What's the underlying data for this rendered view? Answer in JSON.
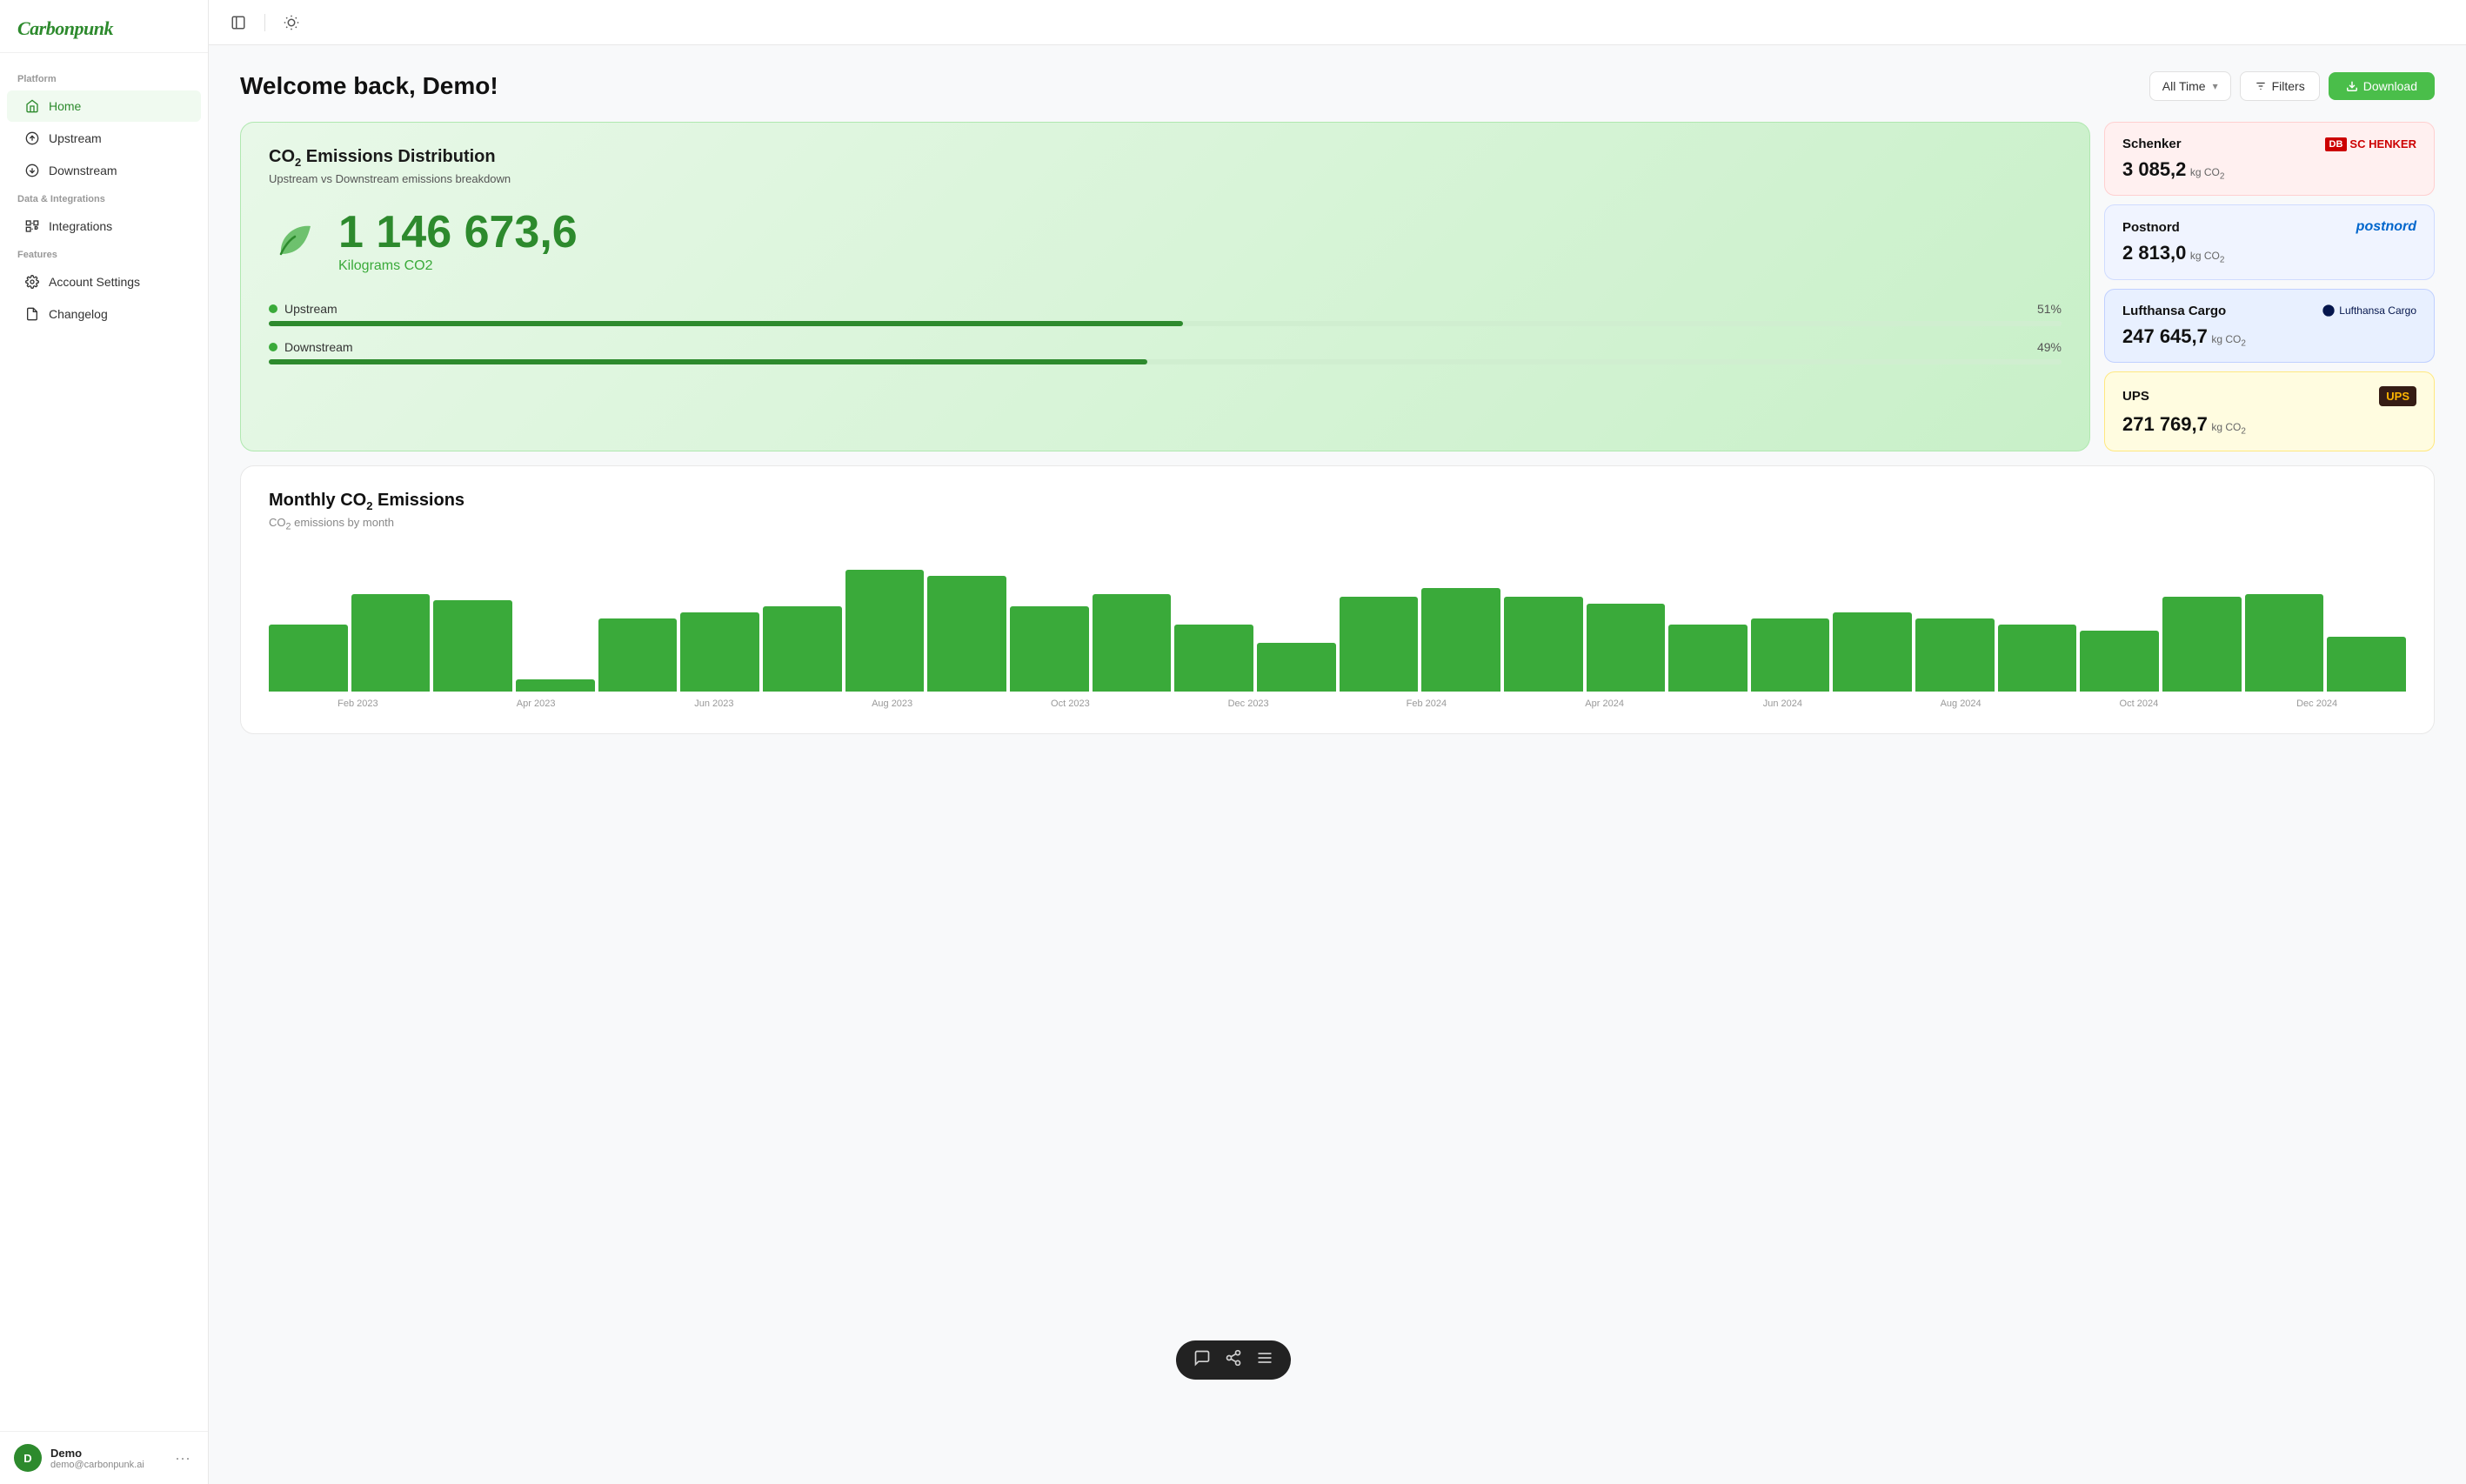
{
  "app": {
    "name": "Carbonpunk"
  },
  "sidebar": {
    "platform_label": "Platform",
    "data_integrations_label": "Data & Integrations",
    "features_label": "Features",
    "items": [
      {
        "id": "home",
        "label": "Home",
        "active": true
      },
      {
        "id": "upstream",
        "label": "Upstream",
        "active": false
      },
      {
        "id": "downstream",
        "label": "Downstream",
        "active": false
      },
      {
        "id": "integrations",
        "label": "Integrations",
        "active": false
      },
      {
        "id": "account-settings",
        "label": "Account Settings",
        "active": false
      },
      {
        "id": "changelog",
        "label": "Changelog",
        "active": false
      }
    ]
  },
  "user": {
    "initial": "D",
    "name": "Demo",
    "email": "demo@carbonpunk.ai"
  },
  "header": {
    "title": "Welcome back, Demo!",
    "time_select": "All Time",
    "filters_label": "Filters",
    "download_label": "Download"
  },
  "emissions_card": {
    "title": "CO₂ Emissions Distribution",
    "subtitle": "Upstream vs Downstream emissions breakdown",
    "value": "1 146 673,6",
    "unit": "Kilograms CO2",
    "upstream_label": "Upstream",
    "upstream_pct": "51%",
    "upstream_fill": 51,
    "downstream_label": "Downstream",
    "downstream_pct": "49%",
    "downstream_fill": 49
  },
  "carriers": [
    {
      "name": "Schenker",
      "logo_type": "schenker",
      "value": "3 085,2",
      "unit": "kg CO₂",
      "theme": "pink"
    },
    {
      "name": "Postnord",
      "logo_type": "postnord",
      "value": "2 813,0",
      "unit": "kg CO₂",
      "theme": "blue-light"
    },
    {
      "name": "Lufthansa Cargo",
      "logo_type": "lufthansa",
      "value": "247 645,7",
      "unit": "kg CO₂",
      "theme": "blue"
    },
    {
      "name": "UPS",
      "logo_type": "ups",
      "value": "271 769,7",
      "unit": "kg CO₂",
      "theme": "yellow"
    }
  ],
  "monthly_chart": {
    "title": "Monthly CO₂ Emissions",
    "subtitle": "CO₂ emissions by month",
    "bars": [
      {
        "label": "Feb 2023",
        "height": 55
      },
      {
        "label": "Apr 2023",
        "height": 80
      },
      {
        "label": "",
        "height": 75
      },
      {
        "label": "Jun 2023",
        "height": 10
      },
      {
        "label": "",
        "height": 60
      },
      {
        "label": "",
        "height": 65
      },
      {
        "label": "Aug 2023",
        "height": 70
      },
      {
        "label": "",
        "height": 100
      },
      {
        "label": "",
        "height": 95
      },
      {
        "label": "Oct 2023",
        "height": 70
      },
      {
        "label": "",
        "height": 80
      },
      {
        "label": "Dec 2023",
        "height": 55
      },
      {
        "label": "",
        "height": 40
      },
      {
        "label": "Feb 2024",
        "height": 78
      },
      {
        "label": "",
        "height": 85
      },
      {
        "label": "Apr 2024",
        "height": 78
      },
      {
        "label": "",
        "height": 72
      },
      {
        "label": "Jun 2024",
        "height": 55
      },
      {
        "label": "",
        "height": 60
      },
      {
        "label": "",
        "height": 65
      },
      {
        "label": "Aug 2024",
        "height": 60
      },
      {
        "label": "",
        "height": 55
      },
      {
        "label": "Oct 2024",
        "height": 50
      },
      {
        "label": "",
        "height": 78
      },
      {
        "label": "",
        "height": 80
      },
      {
        "label": "Dec 2024",
        "height": 45
      }
    ],
    "x_labels": [
      "Feb 2023",
      "Apr 2023",
      "Jun 2023",
      "Aug 2023",
      "Oct 2023",
      "Dec 2023",
      "Feb 2024",
      "Apr 2024",
      "Jun 2024",
      "Aug 2024",
      "Oct 2024",
      "Dec 2024"
    ]
  }
}
